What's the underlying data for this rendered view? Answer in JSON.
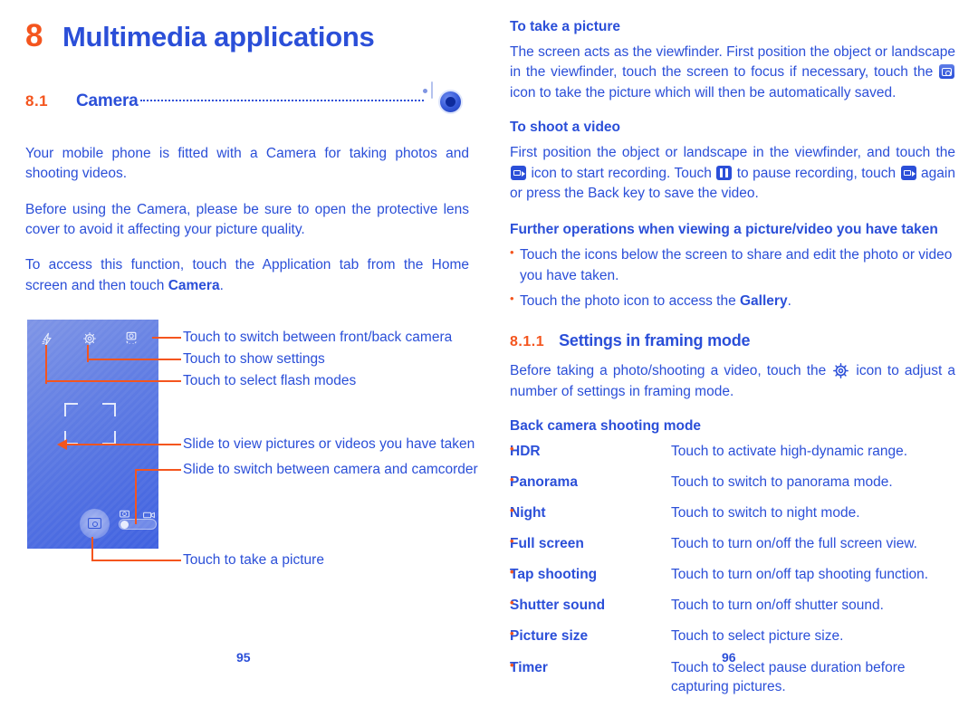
{
  "colors": {
    "text_blue": "#2B4FD8",
    "accent_orange": "#F4551E",
    "phone_screen": "#4f6fe2"
  },
  "left_column": {
    "chapter": {
      "number": "8",
      "title": "Multimedia applications"
    },
    "section": {
      "number": "8.1",
      "label": "Camera",
      "icon": "camera-app-icon"
    },
    "paragraphs": [
      "Your mobile phone is fitted with a Camera for taking photos and shooting videos.",
      "Before using the Camera, please be sure to open the protective lens cover to avoid it affecting your picture quality."
    ],
    "access_paragraph": {
      "before": "To access this function, touch the Application tab from the Home screen and then touch ",
      "bold": "Camera",
      "after": "."
    },
    "figure": {
      "callouts": [
        "Touch to switch between front/back camera",
        "Touch to show settings",
        "Touch to select flash modes",
        "Slide to view pictures or videos you have taken",
        "Slide to switch between camera and camcorder",
        "Touch to take a picture"
      ],
      "phone_icons": {
        "flash": "flash-icon",
        "settings": "gear-icon",
        "flip_camera": "switch-camera-icon",
        "shutter": "shutter-button",
        "toggle_camera": "camera-mode-icon",
        "toggle_video": "camcorder-mode-icon"
      }
    },
    "page_number": "95"
  },
  "right_column": {
    "take_picture": {
      "heading": "To take a picture",
      "text_part1": "The screen acts as the viewfinder. First position the object or landscape in the viewfinder, touch the screen to focus if necessary, touch the ",
      "icon1": "shutter-icon",
      "text_part2": " icon to take the picture which will then be automatically saved."
    },
    "shoot_video": {
      "heading": "To shoot a video",
      "text_part1": "First position the object or landscape in the viewfinder, and touch the ",
      "icon1": "camcorder-icon",
      "text_part2": " icon to start recording. Touch ",
      "icon2": "pause-icon",
      "text_part3": " to pause recording, touch ",
      "icon3": "camcorder-icon",
      "text_part4": " again or press the Back key to save the video."
    },
    "further_operations": {
      "heading": "Further operations when viewing a picture/video you have taken",
      "bullets": [
        {
          "text": "Touch the icons below the screen to share and edit the photo or video you have taken."
        },
        {
          "before": "Touch the photo icon to access the ",
          "bold": "Gallery",
          "after": "."
        }
      ]
    },
    "framing_settings": {
      "number": "8.1.1",
      "heading": "Settings in framing mode",
      "intro_before": "Before taking a photo/shooting a video, touch the ",
      "intro_icon": "gear-icon",
      "intro_after": " icon to adjust a number of settings in framing mode.",
      "table_heading": "Back camera shooting mode",
      "rows": [
        {
          "option": "HDR",
          "description": "Touch to activate high-dynamic range."
        },
        {
          "option": "Panorama",
          "description": "Touch to switch to panorama mode."
        },
        {
          "option": "Night",
          "description": "Touch to switch to night mode."
        },
        {
          "option": "Full screen",
          "description": "Touch to turn on/off the full screen view."
        },
        {
          "option": "Tap shooting",
          "description": "Touch to turn on/off tap shooting function."
        },
        {
          "option": "Shutter sound",
          "description": "Touch to turn on/off shutter sound."
        },
        {
          "option": "Picture size",
          "description": "Touch to select picture size."
        },
        {
          "option": "Timer",
          "description": "Touch to select pause duration before capturing pictures."
        }
      ]
    },
    "page_number": "96"
  }
}
